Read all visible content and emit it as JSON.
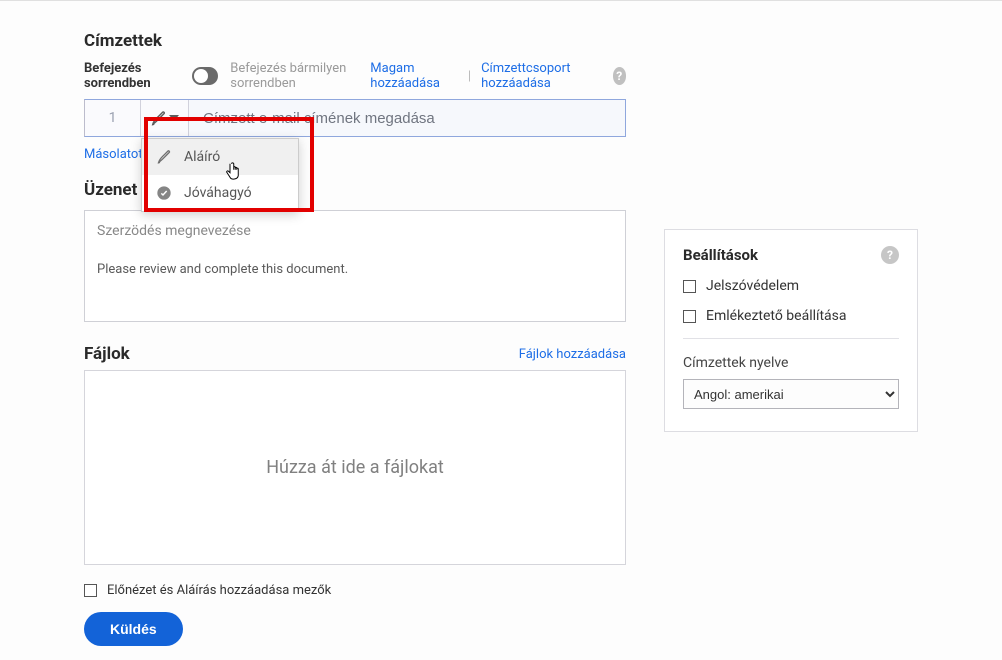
{
  "recipients": {
    "section_title": "Címzettek",
    "complete_in_order": "Befejezés sorrendben",
    "complete_any_order": "Befejezés bármilyen sorrendben",
    "add_me": "Magam hozzáadása",
    "add_group": "Címzettcsoport hozzáadása",
    "row1": {
      "index": "1",
      "email_placeholder": "Címzett e-mail címének megadása"
    },
    "cc_link": "Másolatot k",
    "role_dropdown": {
      "signer": "Aláíró",
      "approver": "Jóváhagyó"
    }
  },
  "message": {
    "section_title": "Üzenet",
    "subject_placeholder": "Szerzödés megnevezése",
    "body_value": "Please review and complete this document."
  },
  "files": {
    "section_title": "Fájlok",
    "add_link": "Fájlok hozzáadása",
    "dropzone_text": "Húzza át ide a fájlokat"
  },
  "preview_checkbox_label": "Előnézet és Aláírás hozzáadása mezők",
  "send_button": "Küldés",
  "settings": {
    "title": "Beállítások",
    "password_protect": "Jelszóvédelem",
    "reminder": "Emlékeztető beállítása",
    "recipient_lang_label": "Címzettek nyelve",
    "lang_selected": "Angol: amerikai"
  }
}
